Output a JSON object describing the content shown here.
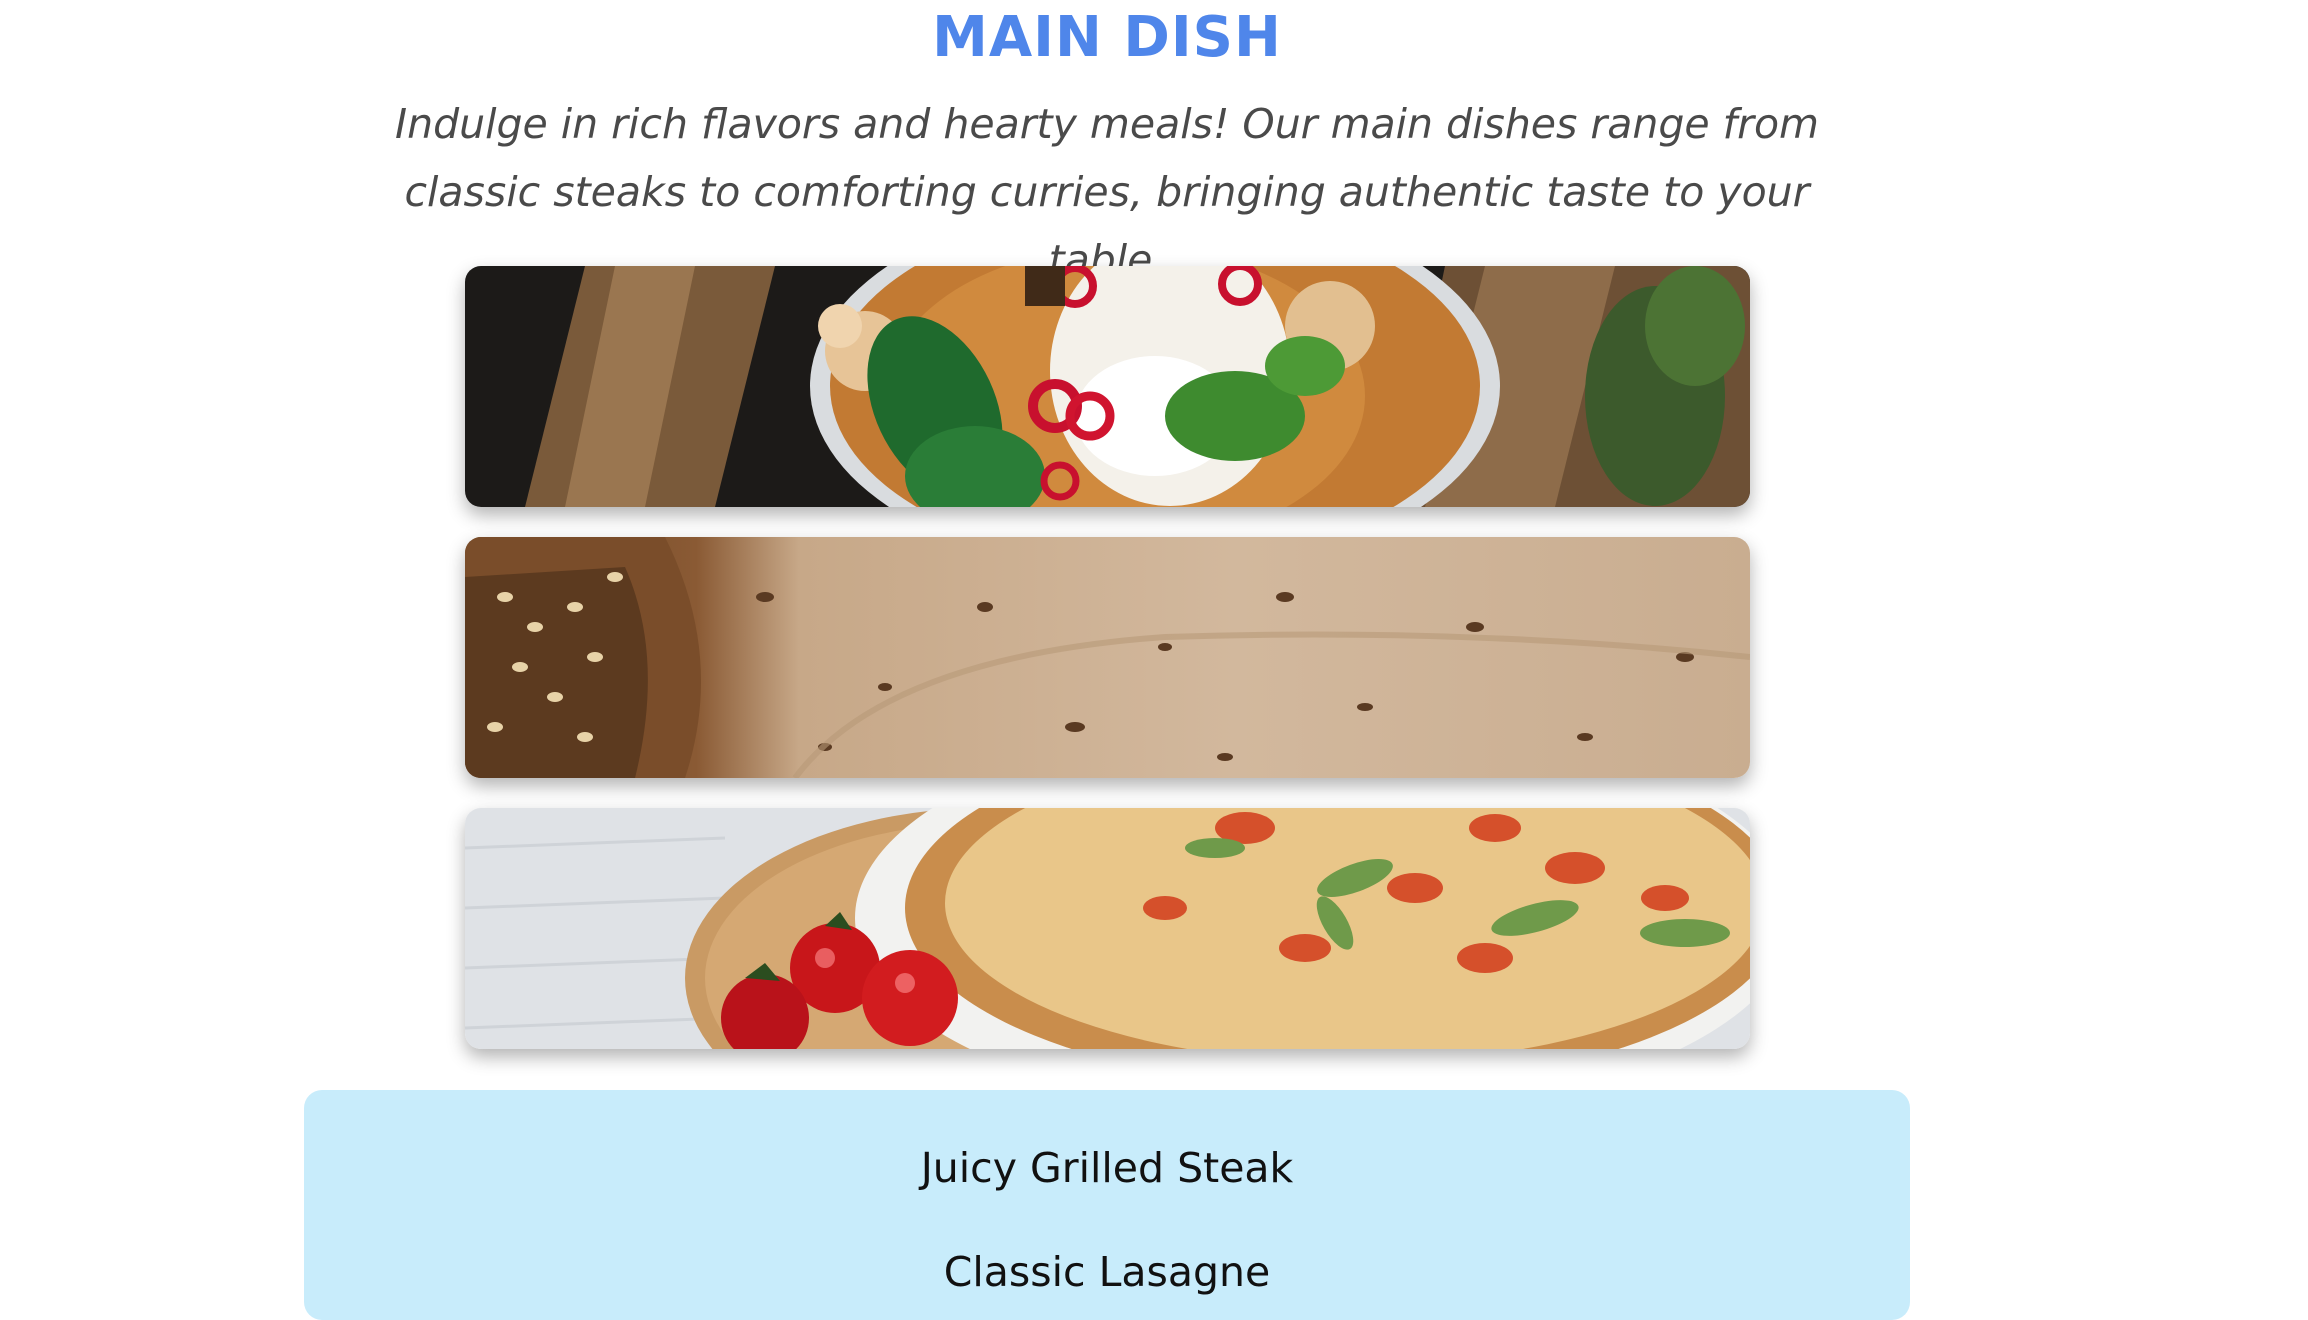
{
  "section": {
    "title": "MAIN DISH",
    "description": "Indulge in rich flavors and hearty meals! Our main dishes range from classic steaks to comforting curries, bringing authentic taste to your table."
  },
  "banners": [
    {
      "name": "curry-rice-image"
    },
    {
      "name": "bread-image"
    },
    {
      "name": "pizza-image"
    }
  ],
  "menu": {
    "items": [
      {
        "label": "Juicy Grilled Steak"
      },
      {
        "label": "Classic Lasagne"
      }
    ]
  },
  "colors": {
    "title": "#4f86ea",
    "menu_background": "#c8ecfb",
    "description": "#4a4a4a"
  }
}
